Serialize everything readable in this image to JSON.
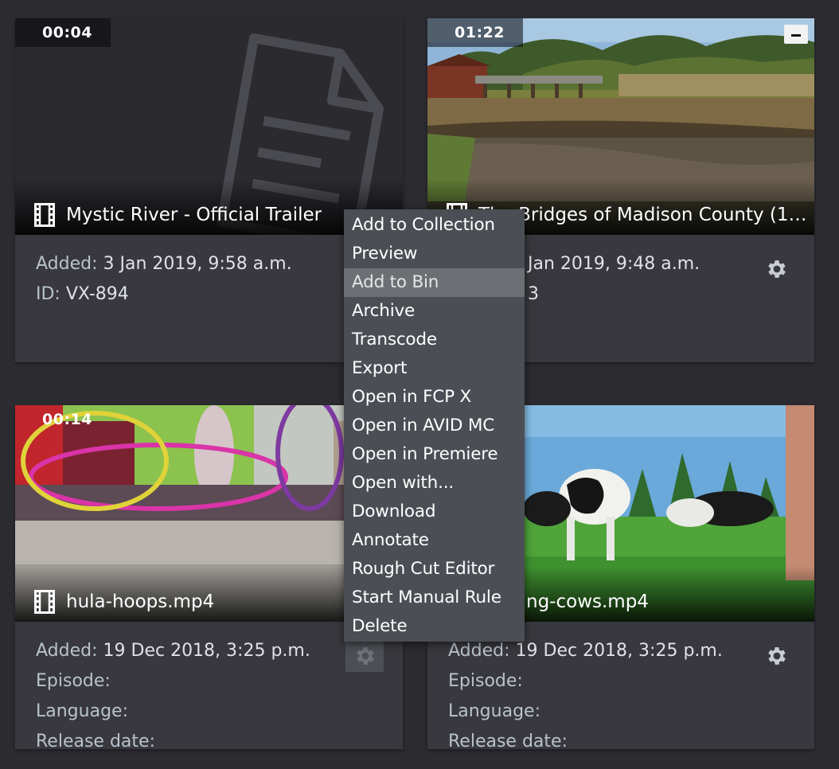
{
  "cards": [
    {
      "duration": "00:04",
      "title": "Mystic River - Official Trailer",
      "meta": [
        {
          "key": "Added:",
          "value": "3 Jan 2019, 9:58 a.m."
        },
        {
          "key": "ID:",
          "value": "VX-894"
        }
      ],
      "thumb_icon": "document-icon"
    },
    {
      "duration": "01:22",
      "title": "The Bridges of Madison County (199…",
      "meta": [
        {
          "key": "",
          "value": "Jan 2019, 9:48 a.m."
        },
        {
          "key": "",
          "value": "3"
        }
      ],
      "badge_icon": "archive-icon"
    },
    {
      "duration": "00:14",
      "title": "hula-hoops.mp4",
      "meta": [
        {
          "key": "Added:",
          "value": "19 Dec 2018, 3:25 p.m."
        },
        {
          "key": "Episode:",
          "value": ""
        },
        {
          "key": "Language:",
          "value": ""
        },
        {
          "key": "Release date:",
          "value": ""
        }
      ]
    },
    {
      "duration": "",
      "title": "ng-cows.mp4",
      "meta": [
        {
          "key": "Added:",
          "value": "19 Dec 2018, 3:25 p.m."
        },
        {
          "key": "Episode:",
          "value": ""
        },
        {
          "key": "Language:",
          "value": ""
        },
        {
          "key": "Release date:",
          "value": ""
        }
      ]
    }
  ],
  "context_menu": {
    "items": [
      "Add to Collection",
      "Preview",
      "Add to Bin",
      "Archive",
      "Transcode",
      "Export",
      "Open in FCP X",
      "Open in AVID MC",
      "Open in Premiere",
      "Open with...",
      "Download",
      "Annotate",
      "Rough Cut Editor",
      "Start Manual Rule",
      "Delete"
    ],
    "highlighted": "Add to Bin"
  },
  "colors": {
    "background": "#2b2b30",
    "card": "#38383e",
    "menu": "#4b4e54",
    "menu_highlight": "#6c6f74"
  }
}
